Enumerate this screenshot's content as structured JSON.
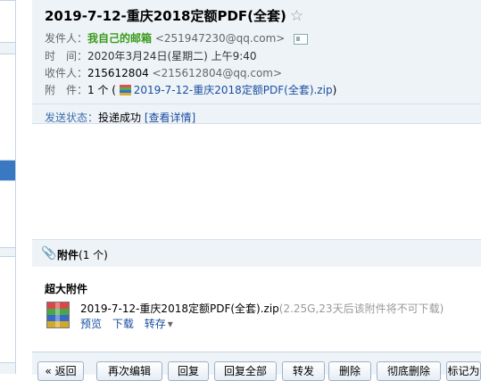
{
  "mail": {
    "subject": "2019-7-12-重庆2018定额PDF(全套)",
    "star": "☆",
    "sender_label": "发件人：",
    "sender_name": "我自己的邮箱",
    "sender_email": "<251947230@qq.com>",
    "time_label": "时　间：",
    "time_value": "2020年3月24日(星期二) 上午9:40",
    "recipient_label": "收件人：",
    "recipient_name": "215612804",
    "recipient_email": "<215612804@qq.com>",
    "attachment_label": "附　件：",
    "attachment_count": "1 个 (",
    "attachment_name": "2019-7-12-重庆2018定额PDF(全套).zip",
    "attachment_close": ")",
    "status_label": "发送状态：",
    "status_value": "投递成功",
    "status_detail": "[查看详情]"
  },
  "attachments": {
    "title": "附件",
    "count": "(1 个)",
    "section_label": "超大附件",
    "file_name": "2019-7-12-重庆2018定额PDF(全套).zip",
    "file_meta": "(2.25G,23天后该附件将不可下载)",
    "preview": "预览",
    "download": "下载",
    "save": "转存",
    "save_caret": "▾"
  },
  "toolbar": {
    "back": "« 返回",
    "reedit": "再次编辑",
    "reply": "回复",
    "reply_all": "回复全部",
    "forward": "转发",
    "delete": "删除",
    "delete_forever": "彻底删除",
    "mark": "标记为"
  },
  "colors": {
    "header_bg": "#eef3f8",
    "link": "#1a4fa0",
    "sender_green": "#3a9a1a"
  }
}
